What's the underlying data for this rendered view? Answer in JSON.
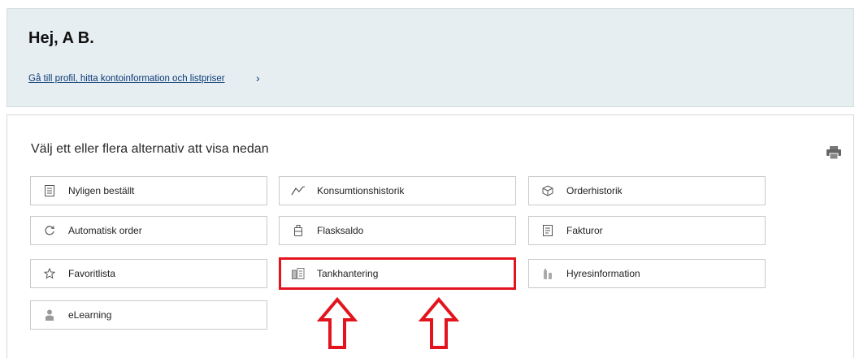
{
  "header": {
    "greeting": "Hej, A B.",
    "profile_link": "Gå till profil, hitta kontoinformation och listpriser",
    "profile_chevron": "›"
  },
  "options": {
    "heading": "Välj ett eller flera alternativ att visa nedan",
    "items": [
      {
        "label": "Nyligen beställt",
        "icon": "document-list-icon"
      },
      {
        "label": "Konsumtionshistorik",
        "icon": "usage-icon"
      },
      {
        "label": "Orderhistorik",
        "icon": "package-icon"
      },
      {
        "label": "Automatisk order",
        "icon": "refresh-icon"
      },
      {
        "label": "Flasksaldo",
        "icon": "bottle-icon"
      },
      {
        "label": "Fakturor",
        "icon": "invoice-icon"
      },
      {
        "label": "Favoritlista",
        "icon": "star-icon"
      },
      {
        "label": "Tankhantering",
        "icon": "tank-icon"
      },
      {
        "label": "Hyresinformation",
        "icon": "cylinder-icon"
      },
      {
        "label": "eLearning",
        "icon": "learner-icon"
      }
    ]
  },
  "colors": {
    "header_bg": "#e6eef2",
    "link": "#0b3a75",
    "highlight": "#e3141e"
  }
}
